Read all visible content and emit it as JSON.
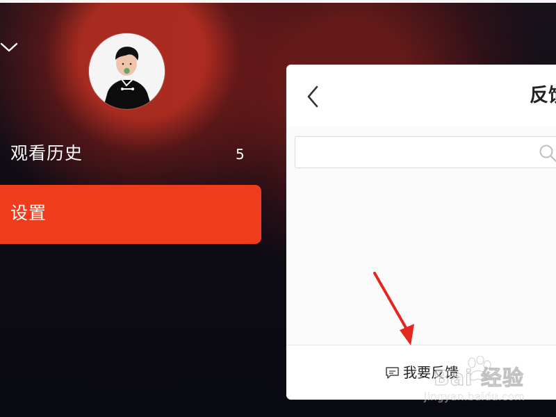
{
  "app": {
    "background_color": "#0d0b14",
    "accent_color": "#ee3c1d"
  },
  "profile": {
    "avatar_icon": "user-avatar"
  },
  "side_menu": {
    "items": [
      {
        "label": "观看历史",
        "count": "5"
      },
      {
        "label": "设置",
        "selected": true
      }
    ]
  },
  "feedback_panel": {
    "title": "反馈",
    "search_placeholder": "",
    "search_icon": "search-icon",
    "action_label": "我要反馈",
    "action_icon": "message-icon"
  },
  "annotation": {
    "arrow_color": "#e3261e"
  },
  "watermark": {
    "brand": "Bai 经验",
    "site": "jingyan.baidu.com"
  }
}
